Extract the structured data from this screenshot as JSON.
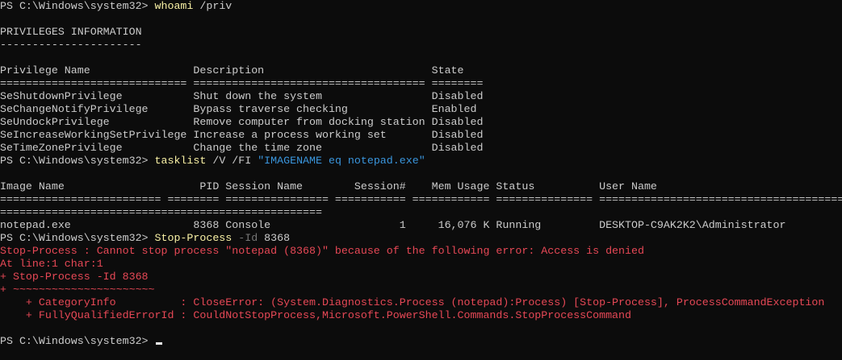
{
  "colors": {
    "background": "#0c0c0c",
    "default_text": "#cccccc",
    "command": "#f9f1a5",
    "string": "#3a96dd",
    "parameter": "#767676",
    "error": "#e74856"
  },
  "lines": [
    [
      {
        "t": "PS C:\\Windows\\system32> ",
        "c": "default"
      },
      {
        "t": "whoami",
        "c": "cmd"
      },
      {
        "t": " /priv",
        "c": "default"
      }
    ],
    [],
    [
      {
        "t": "PRIVILEGES INFORMATION",
        "c": "default"
      }
    ],
    [
      {
        "t": "----------------------",
        "c": "default"
      }
    ],
    [],
    [
      {
        "t": "Privilege Name                Description                          State",
        "c": "default"
      }
    ],
    [
      {
        "t": "============================= ==================================== ========",
        "c": "default"
      }
    ],
    [
      {
        "t": "SeShutdownPrivilege           Shut down the system                 Disabled",
        "c": "default"
      }
    ],
    [
      {
        "t": "SeChangeNotifyPrivilege       Bypass traverse checking             Enabled",
        "c": "default"
      }
    ],
    [
      {
        "t": "SeUndockPrivilege             Remove computer from docking station Disabled",
        "c": "default"
      }
    ],
    [
      {
        "t": "SeIncreaseWorkingSetPrivilege Increase a process working set       Disabled",
        "c": "default"
      }
    ],
    [
      {
        "t": "SeTimeZonePrivilege           Change the time zone                 Disabled",
        "c": "default"
      }
    ],
    [
      {
        "t": "PS C:\\Windows\\system32> ",
        "c": "default"
      },
      {
        "t": "tasklist",
        "c": "cmd"
      },
      {
        "t": " /V /FI ",
        "c": "default"
      },
      {
        "t": "\"IMAGENAME eq notepad.exe\"",
        "c": "string"
      }
    ],
    [],
    [
      {
        "t": "Image Name                     PID Session Name        Session#    Mem Usage Status          User Name",
        "c": "default"
      }
    ],
    [
      {
        "t": "========================= ======== ================ =========== ============ =============== ==================================================",
        "c": "default"
      }
    ],
    [
      {
        "t": "==================================================",
        "c": "default"
      }
    ],
    [
      {
        "t": "notepad.exe                   8368 Console                    1     16,076 K Running         DESKTOP-C9AK2K2\\Administrator",
        "c": "default"
      }
    ],
    [
      {
        "t": "PS C:\\Windows\\system32> ",
        "c": "default"
      },
      {
        "t": "Stop-Process",
        "c": "cmd"
      },
      {
        "t": " -Id",
        "c": "param"
      },
      {
        "t": " 8368",
        "c": "default"
      }
    ],
    [
      {
        "t": "Stop-Process : Cannot stop process \"notepad (8368)\" because of the following error: Access is denied",
        "c": "error"
      }
    ],
    [
      {
        "t": "At line:1 char:1",
        "c": "error"
      }
    ],
    [
      {
        "t": "+ Stop-Process -Id 8368",
        "c": "error"
      }
    ],
    [
      {
        "t": "+ ~~~~~~~~~~~~~~~~~~~~~~",
        "c": "error"
      }
    ],
    [
      {
        "t": "    + CategoryInfo          : CloseError: (System.Diagnostics.Process (notepad):Process) [Stop-Process], ProcessCommandException",
        "c": "error"
      }
    ],
    [
      {
        "t": "    + FullyQualifiedErrorId : CouldNotStopProcess,Microsoft.PowerShell.Commands.StopProcessCommand",
        "c": "error"
      }
    ],
    [],
    [
      {
        "t": "PS C:\\Windows\\system32> ",
        "c": "default"
      }
    ]
  ],
  "cursor_line": 26
}
